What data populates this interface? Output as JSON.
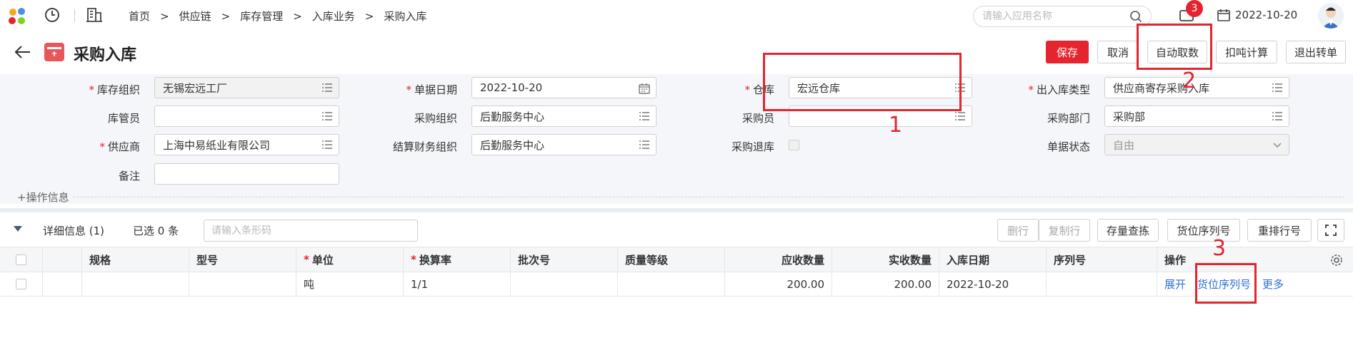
{
  "topbar": {
    "breadcrumbs": [
      "首页",
      "供应链",
      "库存管理",
      "入库业务",
      "采购入库"
    ],
    "search_placeholder": "请输入应用名称",
    "notification_count": "3",
    "date": "2022-10-20"
  },
  "page": {
    "title": "采购入库",
    "buttons": {
      "save": "保存",
      "cancel": "取消",
      "auto_fetch": "自动取数",
      "deduct_calc": "扣吨计算",
      "exit_transfer": "退出转单"
    }
  },
  "form": {
    "inventory_org": {
      "label": "库存组织",
      "value": "无锡宏远工厂"
    },
    "doc_date": {
      "label": "单据日期",
      "value": "2022-10-20"
    },
    "warehouse": {
      "label": "仓库",
      "value": "宏远仓库"
    },
    "io_type": {
      "label": "出入库类型",
      "value": "供应商寄存采购入库"
    },
    "keeper": {
      "label": "库管员",
      "value": ""
    },
    "purchase_org": {
      "label": "采购组织",
      "value": "后勤服务中心"
    },
    "buyer": {
      "label": "采购员",
      "value": ""
    },
    "purchase_dept": {
      "label": "采购部门",
      "value": "采购部"
    },
    "supplier": {
      "label": "供应商",
      "value": "上海中易纸业有限公司"
    },
    "settle_org": {
      "label": "结算财务组织",
      "value": "后勤服务中心"
    },
    "purchase_return": {
      "label": "采购退库"
    },
    "doc_status": {
      "label": "单据状态",
      "value": "自由"
    },
    "remark": {
      "label": "备注",
      "value": ""
    },
    "op_info": "+操作信息"
  },
  "detail": {
    "title": "详细信息 (1)",
    "selected": "已选 0 条",
    "barcode_placeholder": "请输入条形码",
    "buttons": {
      "delete_row": "删行",
      "copy_row": "复制行",
      "stock_query": "存量查拣",
      "serial": "货位序列号",
      "reorder": "重排行号"
    },
    "columns": [
      "规格",
      "型号",
      "单位",
      "换算率",
      "批次号",
      "质量等级",
      "应收数量",
      "实收数量",
      "入库日期",
      "序列号",
      "操作"
    ],
    "rows": [
      {
        "spec": "",
        "model": "",
        "unit": "吨",
        "rate": "1/1",
        "batch": "",
        "quality": "",
        "due_qty": "200.00",
        "actual_qty": "200.00",
        "in_date": "2022-10-20",
        "serial": "",
        "ops": [
          "展开",
          "货位序列号",
          "更多"
        ]
      }
    ]
  },
  "annotations": [
    "1",
    "2",
    "3"
  ],
  "colors": {
    "brand_red": "#e4242e",
    "link_blue": "#2e6fd8",
    "form_bg": "#f4f6f9"
  }
}
